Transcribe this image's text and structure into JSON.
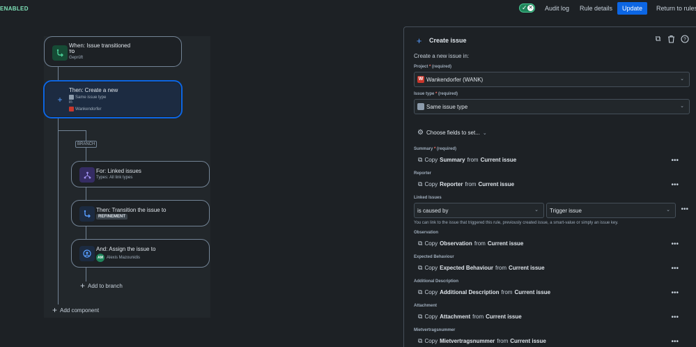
{
  "status": {
    "enabled_label": "ENABLED"
  },
  "toolbar": {
    "audit_log": "Audit log",
    "rule_details": "Rule details",
    "update": "Update",
    "return_to_rules": "Return to rules"
  },
  "flow": {
    "trigger": {
      "title": "When: Issue transitioned",
      "to_label": "TO",
      "status": "Geprüft"
    },
    "create": {
      "title": "Then: Create a new",
      "type": "Same issue type",
      "in_label": "in",
      "project": "Wankendorfer"
    },
    "branch_label": "BRANCH",
    "for_linked": {
      "title": "For: Linked issues",
      "subtitle": "Types: All link types"
    },
    "transition": {
      "title": "Then: Transition the issue to",
      "status": "REFINEMENT"
    },
    "assign": {
      "title": "And: Assign the issue to",
      "initials": "AM",
      "user": "Alexis Mazounidis"
    },
    "add_to_branch": "Add to branch",
    "add_component": "Add component"
  },
  "panel": {
    "title": "Create issue",
    "subheading": "Create a new issue in:",
    "project_label": "Project",
    "project_required": "* ",
    "project_req_text": "(required)",
    "project_value": "Wankendorfer (WANK)",
    "issue_type_label": "Issue type",
    "issue_type_required": "* ",
    "issue_type_req_text": "(required)",
    "issue_type_value": "Same issue type",
    "choose_fields": "Choose fields to set...",
    "fields": [
      {
        "label": "Summary",
        "required": "* ",
        "req_text": "(required)",
        "copy": "Copy",
        "field": "Summary",
        "from": "from",
        "source": "Current issue"
      },
      {
        "label": "Reporter",
        "copy": "Copy",
        "field": "Reporter",
        "from": "from",
        "source": "Current issue"
      },
      {
        "label": "Linked Issues"
      },
      {
        "label": "Observation",
        "copy": "Copy",
        "field": "Observation",
        "from": "from",
        "source": "Current issue"
      },
      {
        "label": "Expected Behaviour",
        "copy": "Copy",
        "field": "Expected Behaviour",
        "from": "from",
        "source": "Current issue"
      },
      {
        "label": "Additional Description",
        "copy": "Copy",
        "field": "Additional Description",
        "from": "from",
        "source": "Current issue"
      },
      {
        "label": "Attachment",
        "copy": "Copy",
        "field": "Attachment",
        "from": "from",
        "source": "Current issue"
      },
      {
        "label": "Mietvertragsnummer",
        "copy": "Copy",
        "field": "Mietvertragsnummer",
        "from": "from",
        "source": "Current issue"
      }
    ],
    "linked": {
      "relation": "is caused by",
      "target": "Trigger issue",
      "hint": "You can link to the issue that triggered this rule, previously created issue, a smart-value or simply an issue key."
    }
  },
  "colors": {
    "accent": "#0c66e4",
    "enabled": "#4bce97",
    "background": "#1d2125"
  }
}
